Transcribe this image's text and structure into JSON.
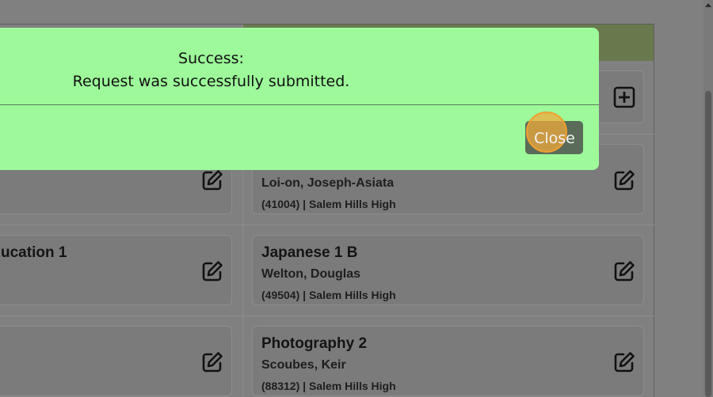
{
  "modal": {
    "title": "Success:",
    "message": "Request was successfully submitted.",
    "close_label": "Close",
    "background_color": "#9df99a"
  },
  "cards": {
    "left": [
      {
        "title": "",
        "teacher": "",
        "school": ""
      },
      {
        "title": "ucation 1",
        "teacher": "",
        "school": ""
      },
      {
        "title": "",
        "teacher": "",
        "school": ""
      }
    ],
    "right": [
      {
        "title": "",
        "teacher": "Loi-on, Joseph-Asiata",
        "school": "(41004) | Salem Hills High"
      },
      {
        "title": "Japanese 1 B",
        "teacher": "Welton, Douglas",
        "school": "(49504) | Salem Hills High"
      },
      {
        "title": "Photography 2",
        "teacher": "Scoubes, Keir",
        "school": "(88312) | Salem Hills High"
      }
    ]
  },
  "icons": {
    "edit": "edit-icon",
    "add": "add-icon"
  }
}
